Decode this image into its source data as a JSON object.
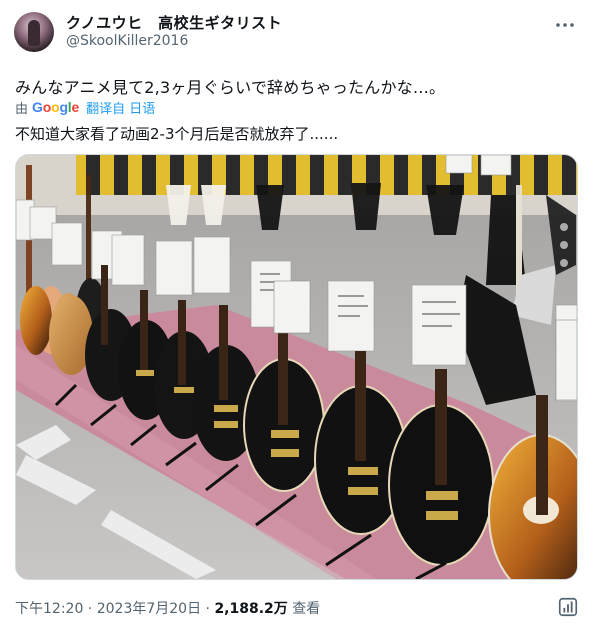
{
  "author": {
    "display_name": "クノユウヒ　高校生ギタリスト",
    "handle": "@SkoolKiller2016"
  },
  "tweet": {
    "text": "みんなアニメ見て2,3ヶ月ぐらいで辞めちゃったんかな…。",
    "translation": {
      "by_label": "由",
      "provider": "Google",
      "link_label": "翻译自 日语",
      "translated_text": "不知道大家看了动画2-3个月后是否就放弃了......"
    }
  },
  "meta": {
    "time": "下午12:20",
    "separator": " · ",
    "date": "2023年7月20日",
    "views_count": "2,188.2万",
    "views_label": " 查看"
  },
  "icons": {
    "more": "more-dots-icon",
    "analytics": "view-analytics-icon",
    "avatar": "user-avatar"
  },
  "colors": {
    "accent": "#1d9bf0",
    "secondary_text": "#536471",
    "google_blue": "#4285f4",
    "google_red": "#ea4335",
    "google_yellow": "#fbbc05",
    "google_green": "#34a853"
  }
}
